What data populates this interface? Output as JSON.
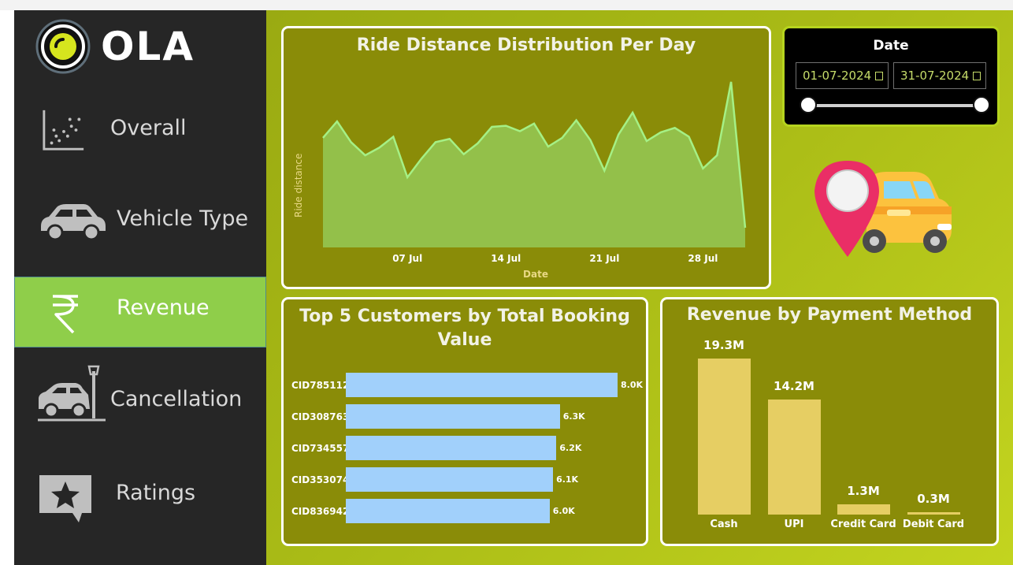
{
  "brand": {
    "name": "OLA"
  },
  "sidebar": {
    "items": [
      {
        "label": "Overall",
        "icon": "scatter-chart-icon",
        "active": false
      },
      {
        "label": "Vehicle Type",
        "icon": "car-icon",
        "active": false
      },
      {
        "label": "Revenue",
        "icon": "rupee-icon",
        "active": true
      },
      {
        "label": "Cancellation",
        "icon": "car-crash-icon",
        "active": false
      },
      {
        "label": "Ratings",
        "icon": "star-message-icon",
        "active": false
      }
    ]
  },
  "date_filter": {
    "title": "Date",
    "start": "01-07-2024",
    "end": "31-07-2024",
    "range_fraction": [
      0,
      1
    ]
  },
  "colors": {
    "sidebar_bg": "#262626",
    "active_nav": "#8fce4a",
    "panel_bg": "#8a8c08",
    "area_fill": "#93c04a",
    "area_line": "#a5f085",
    "customer_bar": "#a1d0fb",
    "payment_bar": "#e6ce63"
  },
  "chart_data": [
    {
      "type": "area",
      "title": "Ride Distance Distribution Per Day",
      "xlabel": "Date",
      "ylabel": "Ride distance",
      "x": [
        "01 Jul",
        "02 Jul",
        "03 Jul",
        "04 Jul",
        "05 Jul",
        "06 Jul",
        "07 Jul",
        "08 Jul",
        "09 Jul",
        "10 Jul",
        "11 Jul",
        "12 Jul",
        "13 Jul",
        "14 Jul",
        "15 Jul",
        "16 Jul",
        "17 Jul",
        "18 Jul",
        "19 Jul",
        "20 Jul",
        "21 Jul",
        "22 Jul",
        "23 Jul",
        "24 Jul",
        "25 Jul",
        "26 Jul",
        "27 Jul",
        "28 Jul",
        "29 Jul",
        "30 Jul",
        "31 Jul"
      ],
      "xticks": [
        "07 Jul",
        "14 Jul",
        "21 Jul",
        "28 Jul"
      ],
      "values": [
        100,
        115,
        96,
        84,
        91,
        101,
        64,
        81,
        96,
        99,
        85,
        95,
        110,
        111,
        106,
        113,
        92,
        100,
        116,
        98,
        70,
        103,
        123,
        97,
        105,
        109,
        101,
        72,
        84,
        151,
        18
      ],
      "ylim": [
        0,
        161
      ],
      "grid": false,
      "legend": "none"
    },
    {
      "type": "bar",
      "orientation": "horizontal",
      "title": "Top 5 Customers by Total Booking Value",
      "categories": [
        "CID785112",
        "CID308763",
        "CID734557",
        "CID353074",
        "CID836942"
      ],
      "values": [
        8.0,
        6.3,
        6.2,
        6.1,
        6.0
      ],
      "value_labels": [
        "8.0K",
        "6.3K",
        "6.2K",
        "6.1K",
        "6.0K"
      ],
      "unit": "K",
      "xlim": [
        0,
        8.0
      ]
    },
    {
      "type": "bar",
      "title": "Revenue by Payment Method",
      "categories": [
        "Cash",
        "UPI",
        "Credit Card",
        "Debit Card"
      ],
      "values": [
        19.3,
        14.2,
        1.3,
        0.3
      ],
      "value_labels": [
        "19.3M",
        "14.2M",
        "1.3M",
        "0.3M"
      ],
      "unit": "M",
      "ylim": [
        0,
        19.3
      ]
    }
  ]
}
